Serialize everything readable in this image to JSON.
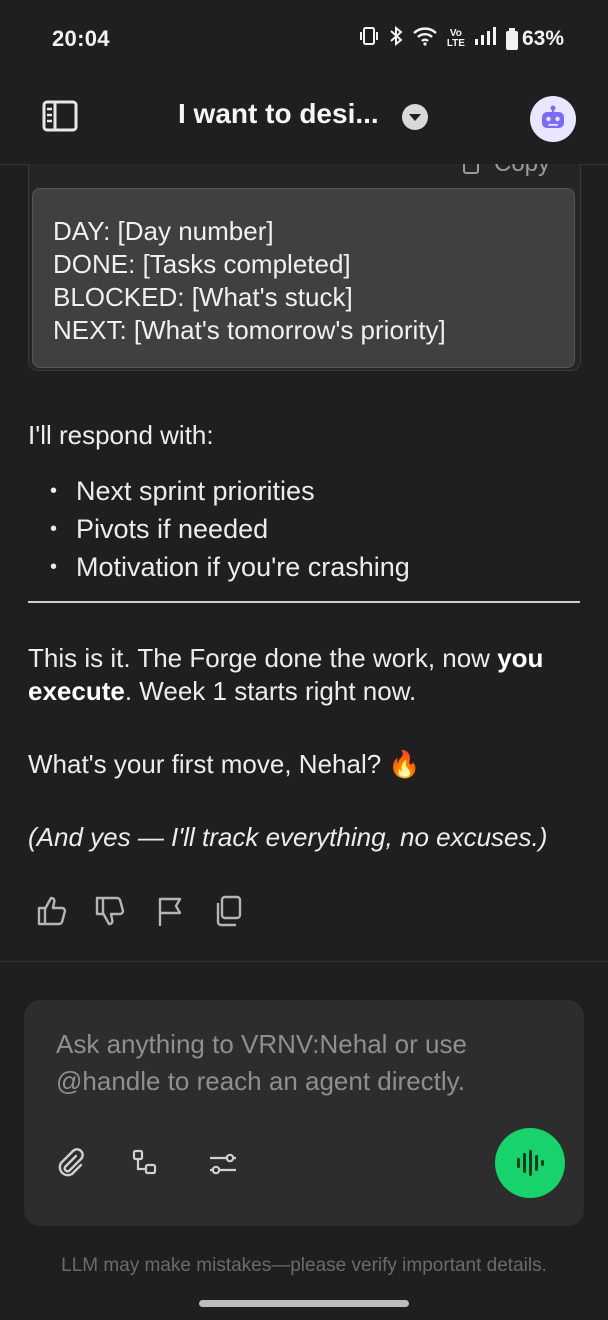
{
  "status_bar": {
    "time": "20:04",
    "battery": "63%",
    "volte": [
      "Vo",
      "LTE"
    ]
  },
  "header": {
    "title": "I want to desi..."
  },
  "code_block": {
    "copy_label": "Copy",
    "lines": [
      "DAY: [Day number]",
      "DONE: [Tasks completed]",
      "BLOCKED: [What's stuck]",
      "NEXT: [What's tomorrow's priority]"
    ]
  },
  "message": {
    "respond_intro": "I'll respond with:",
    "bullets": [
      "Next sprint priorities",
      "Pivots if needed",
      "Motivation if you're crashing"
    ],
    "closing_part1": "This is it. The Forge done the work, now ",
    "closing_bold": "you execute",
    "closing_part2": ". Week 1 starts right now.",
    "question": "What's your first move, Nehal? 🔥",
    "aside": "(And yes — I'll track everything, no excuses.)"
  },
  "composer": {
    "placeholder_line1": "Ask anything to VRNV:Nehal or use",
    "placeholder_line2": "@handle to reach an agent directly."
  },
  "footer_note": "LLM may make mistakes—please verify important details.",
  "colors": {
    "accent_voice": "#18d36b",
    "avatar_bg": "#e9e6ff",
    "avatar_icon": "#7b6cf6"
  }
}
